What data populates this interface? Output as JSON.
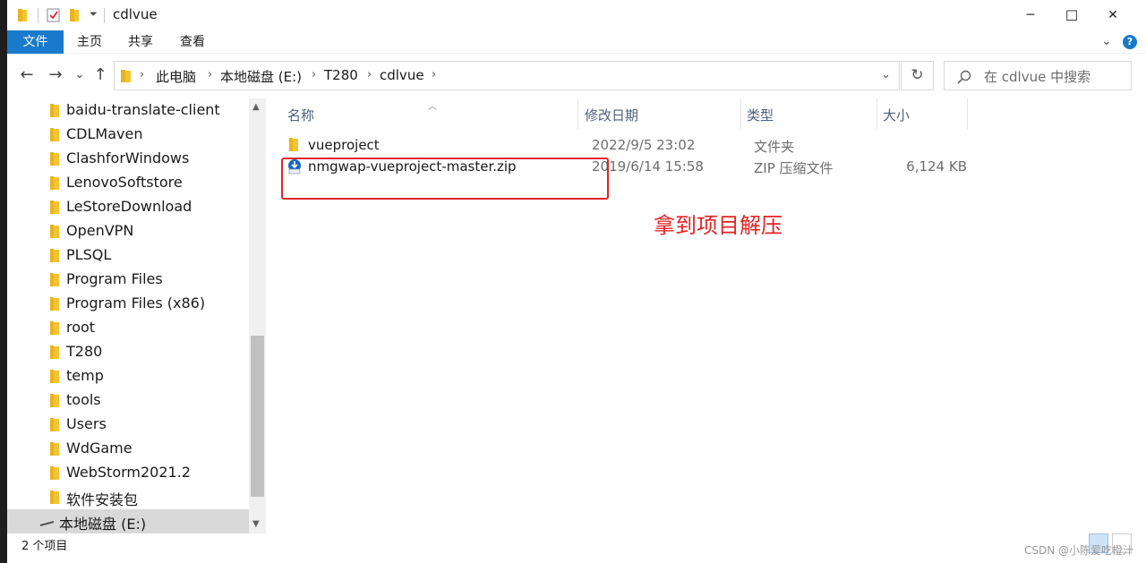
{
  "window": {
    "title": "cdlvue",
    "controls": {
      "minimize": "─",
      "maximize": "☐",
      "close": "✕"
    }
  },
  "ribbon": {
    "tabs": [
      "文件",
      "主页",
      "共享",
      "查看"
    ],
    "help": "?"
  },
  "nav": {
    "back": "←",
    "forward": "→",
    "recent": "⌄",
    "up": "↑",
    "breadcrumb": [
      "此电脑",
      "本地磁盘 (E:)",
      "T280",
      "cdlvue"
    ],
    "refresh": "↻",
    "search_placeholder": "在 cdlvue 中搜索"
  },
  "sidebar": {
    "items": [
      "baidu-translate-client",
      "CDLMaven",
      "ClashforWindows",
      "LenovoSoftstore",
      "LeStoreDownload",
      "OpenVPN",
      "PLSQL",
      "Program Files",
      "Program Files (x86)",
      "root",
      "T280",
      "temp",
      "tools",
      "Users",
      "WdGame",
      "WebStorm2021.2",
      "软件安装包"
    ],
    "drive": "本地磁盘 (E:)"
  },
  "filelist": {
    "columns": [
      "名称",
      "修改日期",
      "类型",
      "大小"
    ],
    "rows": [
      {
        "name": "vueproject",
        "date": "2022/9/5 23:02",
        "type": "文件夹",
        "size": ""
      },
      {
        "name": "nmgwap-vueproject-master.zip",
        "date": "2019/6/14 15:58",
        "type": "ZIP 压缩文件",
        "size": "6,124 KB"
      }
    ]
  },
  "annotation": "拿到项目解压",
  "status": {
    "count": "2 个项目"
  },
  "watermark": "CSDN @小陈爱吃橙汁",
  "colors": {
    "accent": "#1979ca",
    "annotation": "#e02424",
    "folder": "#f4c430"
  }
}
